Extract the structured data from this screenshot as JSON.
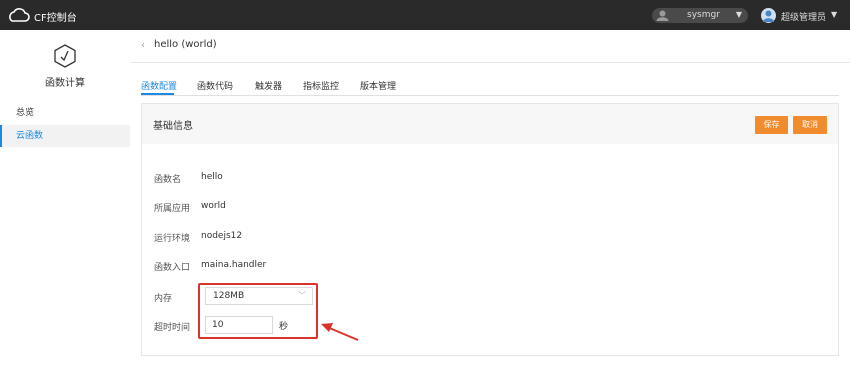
{
  "app": {
    "title": "CF控制台",
    "logo_icon": "cloud-icon"
  },
  "topbar": {
    "user_name": "sysmgr",
    "admin_name": "超级管理员"
  },
  "sidebar": {
    "title": "函数计算",
    "items": [
      {
        "label": "总览",
        "active": false
      },
      {
        "label": "云函数",
        "active": true
      }
    ]
  },
  "header": {
    "breadcrumb": "hello (world)"
  },
  "tabs": [
    {
      "label": "函数配置",
      "active": true
    },
    {
      "label": "函数代码",
      "active": false
    },
    {
      "label": "触发器",
      "active": false
    },
    {
      "label": "指标监控",
      "active": false
    },
    {
      "label": "版本管理",
      "active": false
    }
  ],
  "panel": {
    "title": "基础信息",
    "save_label": "保存",
    "cancel_label": "取消"
  },
  "fields": {
    "name": {
      "label": "函数名",
      "value": "hello"
    },
    "app": {
      "label": "所属应用",
      "value": "world"
    },
    "runtime": {
      "label": "运行环境",
      "value": "nodejs12"
    },
    "entry": {
      "label": "函数入口",
      "value": "maina.handler"
    },
    "memory": {
      "label": "内存",
      "value": "128MB"
    },
    "timeout": {
      "label": "超时时间",
      "value": "10",
      "unit": "秒"
    }
  },
  "colors": {
    "accent": "#1e88e5",
    "button": "#f08c2e",
    "highlight": "#d9342b",
    "topbar": "#2a2a2a"
  }
}
